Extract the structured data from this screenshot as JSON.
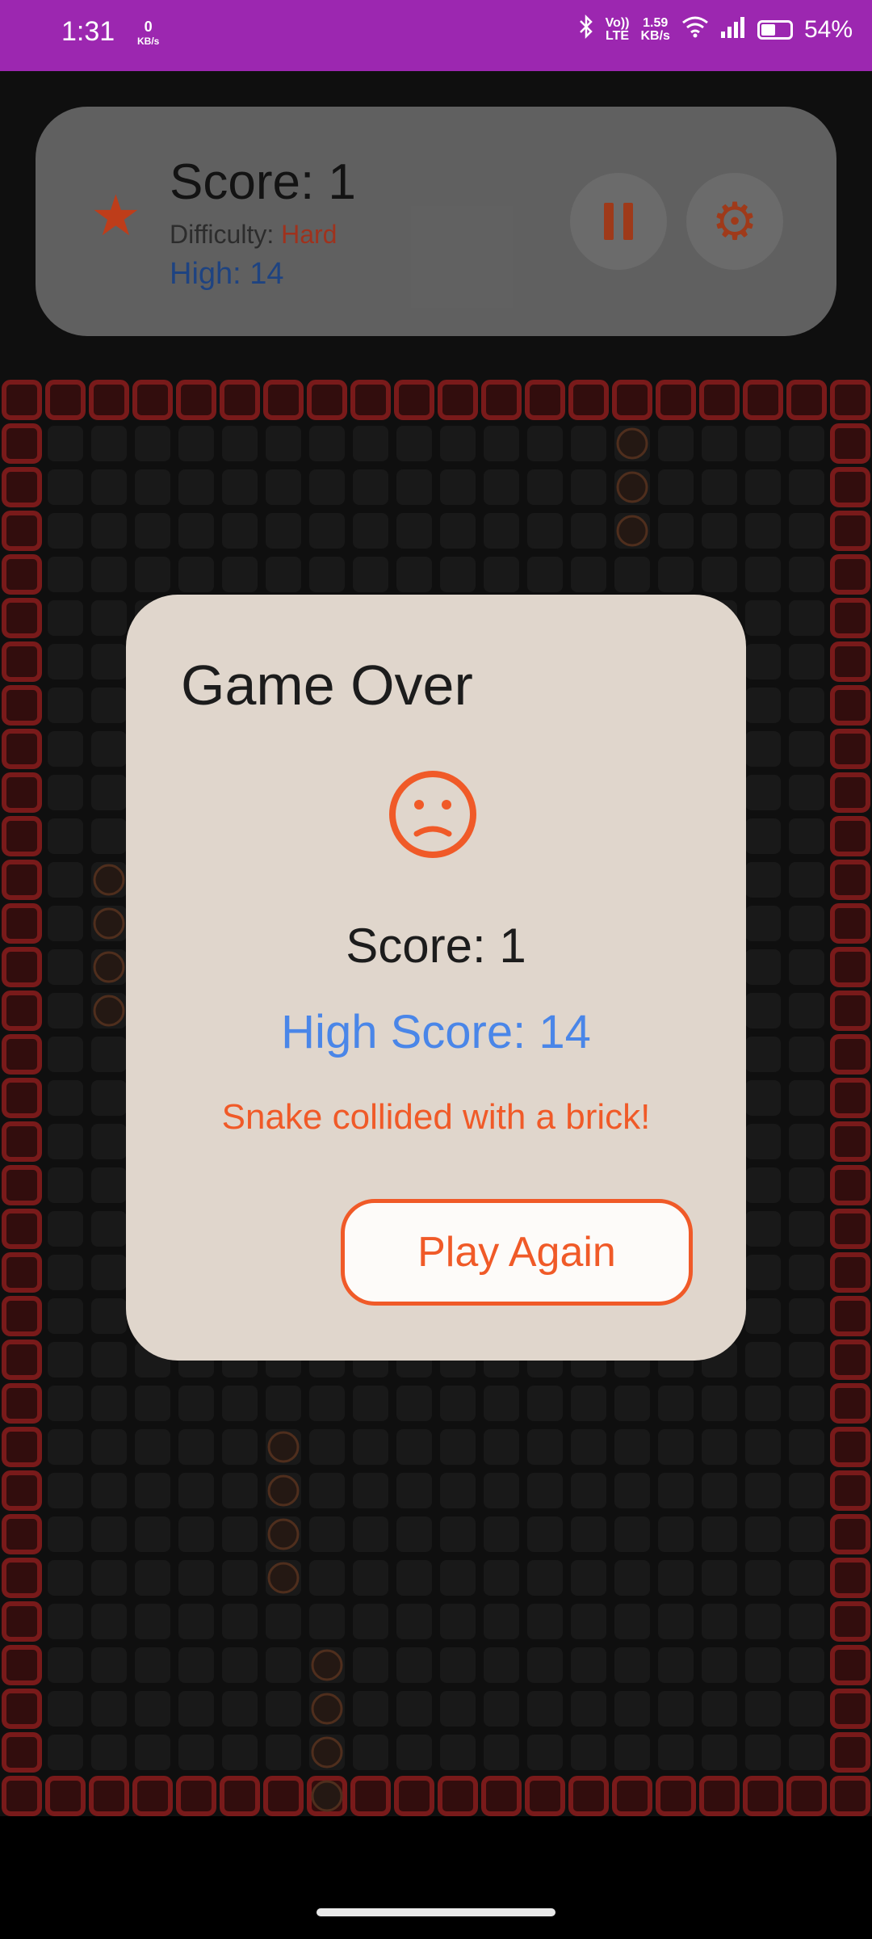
{
  "status_bar": {
    "time": "1:31",
    "speed_value": "0",
    "speed_unit": "KB/s",
    "net_speed_value": "1.59",
    "net_speed_unit": "KB/s",
    "lte_label_1": "Vo))",
    "lte_label_2": "LTE",
    "battery_percent": "54%",
    "battery_level": 0.54,
    "icons": [
      "bluetooth-icon",
      "volte-icon",
      "wifi-icon",
      "signal-icon",
      "battery-icon"
    ]
  },
  "header": {
    "score_text": "Score: 1",
    "difficulty_label": "Difficulty:",
    "difficulty_value": "Hard",
    "high_text": "High: 14",
    "icons": [
      "star-icon",
      "pause-icon",
      "gear-icon"
    ]
  },
  "dialog": {
    "title": "Game Over",
    "score_text": "Score: 1",
    "high_score_text": "High Score: 14",
    "message": "Snake collided with a brick!",
    "play_again_label": "Play Again",
    "icon": "sad-face-icon"
  },
  "colors": {
    "status_bar": "#9c27b0",
    "accent": "#f05a28",
    "high_score_blue": "#4a86e8",
    "brick": "#c62828",
    "dialog_bg": "#e0d6cc"
  }
}
